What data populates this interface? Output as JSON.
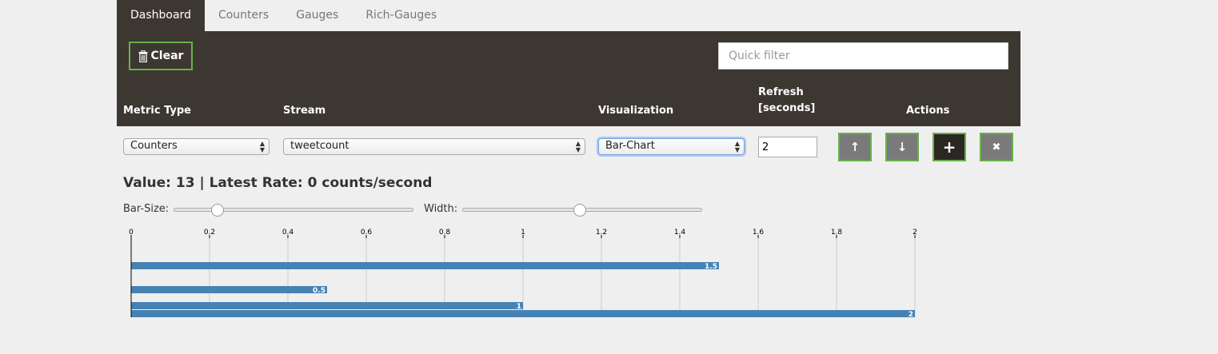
{
  "tabs": [
    {
      "label": "Dashboard",
      "active": true
    },
    {
      "label": "Counters",
      "active": false
    },
    {
      "label": "Gauges",
      "active": false
    },
    {
      "label": "Rich-Gauges",
      "active": false
    }
  ],
  "toolbar": {
    "clear_label": "Clear",
    "clear_icon": "trash-icon",
    "quick_filter_placeholder": "Quick filter",
    "quick_filter_value": ""
  },
  "table": {
    "headers": {
      "metric_type": "Metric Type",
      "stream": "Stream",
      "visualization": "Visualization",
      "refresh_line1": "Refresh",
      "refresh_line2": "[seconds]",
      "actions": "Actions"
    },
    "row": {
      "metric_type": "Counters",
      "stream": "tweetcount",
      "visualization": "Bar-Chart",
      "refresh": "2",
      "actions": [
        {
          "name": "move-up-button",
          "icon": "arrow-up-icon",
          "glyph": "↑"
        },
        {
          "name": "move-down-button",
          "icon": "arrow-down-icon",
          "glyph": "↓"
        },
        {
          "name": "add-button",
          "icon": "plus-icon",
          "glyph": "+"
        },
        {
          "name": "remove-button",
          "icon": "close-icon",
          "glyph": "✖"
        }
      ]
    }
  },
  "value_line": "Value: 13 | Latest Rate: 0 counts/second",
  "sliders": {
    "bar_size_label": "Bar-Size:",
    "bar_size_value": 0.18,
    "width_label": "Width:",
    "width_value": 0.49
  },
  "colors": {
    "accent": "#6bb04a",
    "header_bg": "#3c3731",
    "bar": "#4682b4"
  },
  "chart_data": {
    "type": "bar",
    "orientation": "horizontal",
    "xlim": [
      0,
      2
    ],
    "ticks": [
      "0",
      "0.2",
      "0.4",
      "0.6",
      "0.8",
      "1",
      "1.2",
      "1.4",
      "1.6",
      "1.8",
      "2"
    ],
    "grid": true,
    "values": [
      1.5,
      0.5,
      1,
      2
    ],
    "value_labels": [
      "1.5",
      "0.5",
      "1",
      "2"
    ]
  }
}
